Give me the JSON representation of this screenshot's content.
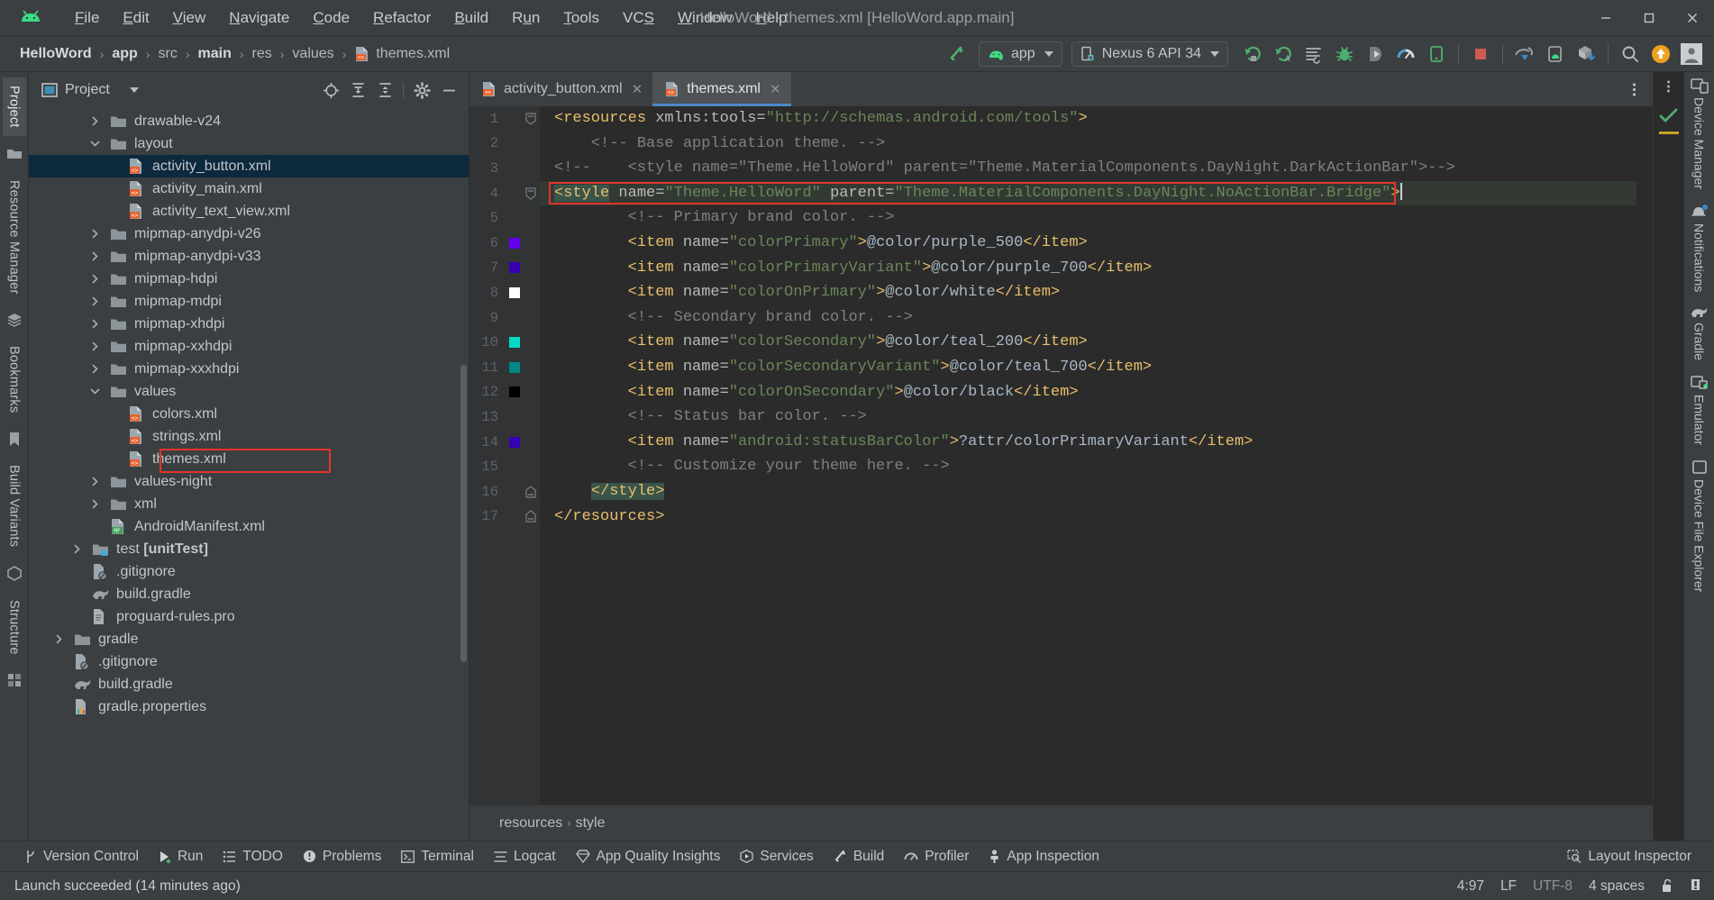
{
  "titlebar": {
    "logo_icon": "android-logo-icon",
    "menus": [
      {
        "label": "File",
        "accel": "F"
      },
      {
        "label": "Edit",
        "accel": "E"
      },
      {
        "label": "View",
        "accel": "V"
      },
      {
        "label": "Navigate",
        "accel": "N"
      },
      {
        "label": "Code",
        "accel": "C"
      },
      {
        "label": "Refactor",
        "accel": "R"
      },
      {
        "label": "Build",
        "accel": "B"
      },
      {
        "label": "Run",
        "accel": "u"
      },
      {
        "label": "Tools",
        "accel": "T"
      },
      {
        "label": "VCS",
        "accel": "S"
      },
      {
        "label": "Window",
        "accel": "W"
      },
      {
        "label": "Help",
        "accel": "H"
      }
    ],
    "window_title": "HelloWord - themes.xml [HelloWord.app.main]",
    "minimize": "—",
    "maximize": "☐",
    "close": "✕"
  },
  "toolbar": {
    "breadcrumbs": [
      {
        "label": "HelloWord",
        "bold": true
      },
      {
        "label": "app",
        "bold": true
      },
      {
        "label": "src",
        "bold": false
      },
      {
        "label": "main",
        "bold": true
      },
      {
        "label": "res",
        "bold": false
      },
      {
        "label": "values",
        "bold": false
      },
      {
        "label": "themes.xml",
        "bold": false,
        "icon": "xml-file-icon"
      }
    ],
    "separator": "›",
    "build_icon": "build-hammer-icon",
    "run_config": {
      "label": "app",
      "icon": "android-app-icon"
    },
    "device": {
      "label": "Nexus 6 API 34",
      "icon": "device-phone-icon"
    },
    "actions": [
      {
        "name": "run-button",
        "icon": "run-arrow-icon"
      },
      {
        "name": "apply-changes-button",
        "icon": "apply-changes-icon"
      },
      {
        "name": "run-with-coverage-button",
        "icon": "coverage-icon"
      },
      {
        "name": "debug-button",
        "icon": "debug-bug-icon"
      },
      {
        "name": "attach-debugger-button",
        "icon": "attach-debugger-icon"
      },
      {
        "name": "profiler-button",
        "icon": "profiler-gauge-icon"
      },
      {
        "name": "logcat-button",
        "icon": "logcat-icon"
      },
      {
        "name": "stop-button",
        "icon": "stop-square-icon"
      },
      {
        "name": "device-mirroring-button",
        "icon": "device-mirror-icon"
      },
      {
        "name": "device-explorer-button",
        "icon": "device-explorer-icon"
      },
      {
        "name": "sdk-download-button",
        "icon": "sdk-download-icon"
      },
      {
        "name": "search-everywhere-button",
        "icon": "search-icon"
      },
      {
        "name": "update-button",
        "icon": "update-arrow-icon"
      },
      {
        "name": "account-button",
        "icon": "avatar-icon"
      }
    ]
  },
  "left_rail": {
    "tabs": [
      {
        "label": "Project",
        "active": true
      },
      {
        "label": "Resource Manager",
        "active": false
      },
      {
        "label": "Bookmarks",
        "active": false
      },
      {
        "label": "Build Variants",
        "active": false
      },
      {
        "label": "Structure",
        "active": false
      }
    ],
    "icons": [
      "folder-icon",
      "layers-icon",
      "bookmark-icon",
      "build-variants-icon",
      "structure-icon"
    ]
  },
  "project_panel": {
    "title": "Project",
    "title_icon": "project-view-icon",
    "dropdown_icon": "chevron-down-icon",
    "header_actions": [
      {
        "name": "select-opened-file-button",
        "icon": "target-crosshair-icon"
      },
      {
        "name": "expand-all-button",
        "icon": "expand-all-icon"
      },
      {
        "name": "collapse-all-button",
        "icon": "collapse-all-icon"
      },
      {
        "name": "settings-button",
        "icon": "gear-icon"
      },
      {
        "name": "hide-button",
        "icon": "minus-icon"
      }
    ],
    "tree": [
      {
        "label": "drawable-v24",
        "indent": 4,
        "arrow": "right",
        "icon": "folder-icon",
        "kind": "folder"
      },
      {
        "label": "layout",
        "indent": 4,
        "arrow": "down",
        "icon": "folder-icon",
        "kind": "folder"
      },
      {
        "label": "activity_button.xml",
        "indent": 5,
        "arrow": "none",
        "icon": "xml-file-icon",
        "kind": "xml",
        "selected": true
      },
      {
        "label": "activity_main.xml",
        "indent": 5,
        "arrow": "none",
        "icon": "xml-file-icon",
        "kind": "xml"
      },
      {
        "label": "activity_text_view.xml",
        "indent": 5,
        "arrow": "none",
        "icon": "xml-file-icon",
        "kind": "xml"
      },
      {
        "label": "mipmap-anydpi-v26",
        "indent": 4,
        "arrow": "right",
        "icon": "folder-icon",
        "kind": "folder"
      },
      {
        "label": "mipmap-anydpi-v33",
        "indent": 4,
        "arrow": "right",
        "icon": "folder-icon",
        "kind": "folder"
      },
      {
        "label": "mipmap-hdpi",
        "indent": 4,
        "arrow": "right",
        "icon": "folder-icon",
        "kind": "folder"
      },
      {
        "label": "mipmap-mdpi",
        "indent": 4,
        "arrow": "right",
        "icon": "folder-icon",
        "kind": "folder"
      },
      {
        "label": "mipmap-xhdpi",
        "indent": 4,
        "arrow": "right",
        "icon": "folder-icon",
        "kind": "folder"
      },
      {
        "label": "mipmap-xxhdpi",
        "indent": 4,
        "arrow": "right",
        "icon": "folder-icon",
        "kind": "folder"
      },
      {
        "label": "mipmap-xxxhdpi",
        "indent": 4,
        "arrow": "right",
        "icon": "folder-icon",
        "kind": "folder"
      },
      {
        "label": "values",
        "indent": 4,
        "arrow": "down",
        "icon": "folder-icon",
        "kind": "folder"
      },
      {
        "label": "colors.xml",
        "indent": 5,
        "arrow": "none",
        "icon": "xml-file-icon",
        "kind": "xml"
      },
      {
        "label": "strings.xml",
        "indent": 5,
        "arrow": "none",
        "icon": "xml-file-icon",
        "kind": "xml"
      },
      {
        "label": "themes.xml",
        "indent": 5,
        "arrow": "none",
        "icon": "xml-file-icon",
        "kind": "xml",
        "highlight_box": true
      },
      {
        "label": "values-night",
        "indent": 4,
        "arrow": "right",
        "icon": "folder-icon",
        "kind": "folder"
      },
      {
        "label": "xml",
        "indent": 4,
        "arrow": "right",
        "icon": "folder-icon",
        "kind": "folder"
      },
      {
        "label": "AndroidManifest.xml",
        "indent": 4,
        "arrow": "none",
        "icon": "manifest-file-icon",
        "kind": "manifest"
      },
      {
        "label": "test [unitTest]",
        "indent": 3,
        "arrow": "right",
        "icon": "test-folder-icon",
        "kind": "folder",
        "bold_part": "[unitTest]"
      },
      {
        "label": ".gitignore",
        "indent": 3,
        "arrow": "none",
        "icon": "gitignore-file-icon",
        "kind": "gitignore"
      },
      {
        "label": "build.gradle",
        "indent": 3,
        "arrow": "none",
        "icon": "gradle-file-icon",
        "kind": "gradle"
      },
      {
        "label": "proguard-rules.pro",
        "indent": 3,
        "arrow": "none",
        "icon": "text-file-icon",
        "kind": "text"
      },
      {
        "label": "gradle",
        "indent": 2,
        "arrow": "right",
        "icon": "folder-icon",
        "kind": "folder"
      },
      {
        "label": ".gitignore",
        "indent": 2,
        "arrow": "none",
        "icon": "gitignore-file-icon",
        "kind": "gitignore"
      },
      {
        "label": "build.gradle",
        "indent": 2,
        "arrow": "none",
        "icon": "gradle-file-icon",
        "kind": "gradle"
      },
      {
        "label": "gradle.properties",
        "indent": 2,
        "arrow": "none",
        "icon": "properties-file-icon",
        "kind": "properties"
      }
    ]
  },
  "editor": {
    "tabs": [
      {
        "label": "activity_button.xml",
        "icon": "xml-file-icon",
        "active": false,
        "close": "✕"
      },
      {
        "label": "themes.xml",
        "icon": "xml-file-icon",
        "active": true,
        "close": "✕"
      }
    ],
    "kebab_icon": "more-options-icon",
    "inspection_status_icon": "inspection-ok-checkmark",
    "line_numbers": [
      1,
      2,
      3,
      4,
      5,
      6,
      7,
      8,
      9,
      10,
      11,
      12,
      13,
      14,
      15,
      16,
      17
    ],
    "gutter_swatches": [
      {
        "line": 6,
        "color": "#6200ee"
      },
      {
        "line": 7,
        "color": "#3700b3"
      },
      {
        "line": 8,
        "color": "#ffffff"
      },
      {
        "line": 10,
        "color": "#03dac5"
      },
      {
        "line": 11,
        "color": "#018786"
      },
      {
        "line": 12,
        "color": "#000000"
      },
      {
        "line": 14,
        "color": "#3700b3"
      }
    ],
    "code_lines": [
      {
        "n": 1,
        "tokens": [
          {
            "t": "<resources",
            "c": "tag"
          },
          {
            "t": " ",
            "c": "txt"
          },
          {
            "t": "xmlns:tools=",
            "c": "attr"
          },
          {
            "t": "\"http://schemas.android.com/tools\"",
            "c": "val"
          },
          {
            "t": ">",
            "c": "tag"
          }
        ]
      },
      {
        "n": 2,
        "tokens": [
          {
            "t": "    <!-- Base application theme. -->",
            "c": "cmt"
          }
        ]
      },
      {
        "n": 3,
        "tokens": [
          {
            "t": "<!--    <style name=\"Theme.HelloWord\" parent=\"Theme.MaterialComponents.DayNight.DarkActionBar\">-->",
            "c": "cmt"
          }
        ]
      },
      {
        "n": 4,
        "highlight": true,
        "boxed": true,
        "tokens": [
          {
            "t": "<style",
            "c": "tag",
            "bg": "green"
          },
          {
            "t": " ",
            "c": "txt"
          },
          {
            "t": "name=",
            "c": "attr"
          },
          {
            "t": "\"Theme.HelloWord\"",
            "c": "val"
          },
          {
            "t": " ",
            "c": "txt"
          },
          {
            "t": "parent=",
            "c": "attr"
          },
          {
            "t": "\"Theme.MaterialComponents.DayNight.NoActionBar.Bridge\"",
            "c": "val"
          },
          {
            "t": ">",
            "c": "tag"
          }
        ],
        "caret": true
      },
      {
        "n": 5,
        "tokens": [
          {
            "t": "        <!-- Primary brand color. -->",
            "c": "cmt"
          }
        ]
      },
      {
        "n": 6,
        "tokens": [
          {
            "t": "        <item",
            "c": "tag"
          },
          {
            "t": " ",
            "c": "txt"
          },
          {
            "t": "name=",
            "c": "attr"
          },
          {
            "t": "\"colorPrimary\"",
            "c": "val"
          },
          {
            "t": ">",
            "c": "tag"
          },
          {
            "t": "@color/purple_500",
            "c": "txt"
          },
          {
            "t": "</item>",
            "c": "tag"
          }
        ]
      },
      {
        "n": 7,
        "tokens": [
          {
            "t": "        <item",
            "c": "tag"
          },
          {
            "t": " ",
            "c": "txt"
          },
          {
            "t": "name=",
            "c": "attr"
          },
          {
            "t": "\"colorPrimaryVariant\"",
            "c": "val"
          },
          {
            "t": ">",
            "c": "tag"
          },
          {
            "t": "@color/purple_700",
            "c": "txt"
          },
          {
            "t": "</item>",
            "c": "tag"
          }
        ]
      },
      {
        "n": 8,
        "tokens": [
          {
            "t": "        <item",
            "c": "tag"
          },
          {
            "t": " ",
            "c": "txt"
          },
          {
            "t": "name=",
            "c": "attr"
          },
          {
            "t": "\"colorOnPrimary\"",
            "c": "val"
          },
          {
            "t": ">",
            "c": "tag"
          },
          {
            "t": "@color/white",
            "c": "txt"
          },
          {
            "t": "</item>",
            "c": "tag"
          }
        ]
      },
      {
        "n": 9,
        "tokens": [
          {
            "t": "        <!-- Secondary brand color. -->",
            "c": "cmt"
          }
        ]
      },
      {
        "n": 10,
        "tokens": [
          {
            "t": "        <item",
            "c": "tag"
          },
          {
            "t": " ",
            "c": "txt"
          },
          {
            "t": "name=",
            "c": "attr"
          },
          {
            "t": "\"colorSecondary\"",
            "c": "val"
          },
          {
            "t": ">",
            "c": "tag"
          },
          {
            "t": "@color/teal_200",
            "c": "txt"
          },
          {
            "t": "</item>",
            "c": "tag"
          }
        ]
      },
      {
        "n": 11,
        "tokens": [
          {
            "t": "        <item",
            "c": "tag"
          },
          {
            "t": " ",
            "c": "txt"
          },
          {
            "t": "name=",
            "c": "attr"
          },
          {
            "t": "\"colorSecondaryVariant\"",
            "c": "val"
          },
          {
            "t": ">",
            "c": "tag"
          },
          {
            "t": "@color/teal_700",
            "c": "txt"
          },
          {
            "t": "</item>",
            "c": "tag"
          }
        ]
      },
      {
        "n": 12,
        "tokens": [
          {
            "t": "        <item",
            "c": "tag"
          },
          {
            "t": " ",
            "c": "txt"
          },
          {
            "t": "name=",
            "c": "attr"
          },
          {
            "t": "\"colorOnSecondary\"",
            "c": "val"
          },
          {
            "t": ">",
            "c": "tag"
          },
          {
            "t": "@color/black",
            "c": "txt"
          },
          {
            "t": "</item>",
            "c": "tag"
          }
        ]
      },
      {
        "n": 13,
        "tokens": [
          {
            "t": "        <!-- Status bar color. -->",
            "c": "cmt"
          }
        ]
      },
      {
        "n": 14,
        "tokens": [
          {
            "t": "        <item",
            "c": "tag"
          },
          {
            "t": " ",
            "c": "txt"
          },
          {
            "t": "name=",
            "c": "attr"
          },
          {
            "t": "\"android:statusBarColor\"",
            "c": "val"
          },
          {
            "t": ">",
            "c": "tag"
          },
          {
            "t": "?attr/colorPrimaryVariant",
            "c": "txt"
          },
          {
            "t": "</item>",
            "c": "tag"
          }
        ]
      },
      {
        "n": 15,
        "tokens": [
          {
            "t": "        <!-- Customize your theme here. -->",
            "c": "cmt"
          }
        ]
      },
      {
        "n": 16,
        "tokens": [
          {
            "t": "    ",
            "c": "txt"
          },
          {
            "t": "</style>",
            "c": "tag",
            "bg": "green"
          }
        ]
      },
      {
        "n": 17,
        "tokens": [
          {
            "t": "</resources>",
            "c": "tag"
          }
        ]
      }
    ],
    "breadcrumbs": [
      "resources",
      "style"
    ],
    "breadcrumb_sep": "›"
  },
  "right_rail": {
    "items": [
      {
        "label": "Device Manager",
        "icon": "device-manager-icon"
      },
      {
        "label": "Notifications",
        "icon": "notifications-bell-icon"
      },
      {
        "label": "Gradle",
        "icon": "gradle-elephant-icon"
      },
      {
        "label": "Emulator",
        "icon": "emulator-icon"
      },
      {
        "label": "Device File Explorer",
        "icon": "device-file-explorer-icon"
      }
    ]
  },
  "bottom_bar": {
    "items": [
      {
        "label": "Version Control",
        "icon": "vcs-branch-icon"
      },
      {
        "label": "Run",
        "icon": "run-arrow-icon"
      },
      {
        "label": "TODO",
        "icon": "todo-list-icon"
      },
      {
        "label": "Problems",
        "icon": "problems-icon"
      },
      {
        "label": "Terminal",
        "icon": "terminal-icon"
      },
      {
        "label": "Logcat",
        "icon": "logcat-icon"
      },
      {
        "label": "App Quality Insights",
        "icon": "app-quality-insights-icon"
      },
      {
        "label": "Services",
        "icon": "services-icon"
      },
      {
        "label": "Build",
        "icon": "build-hammer-icon"
      },
      {
        "label": "Profiler",
        "icon": "profiler-gauge-icon"
      },
      {
        "label": "App Inspection",
        "icon": "app-inspection-icon"
      }
    ],
    "right_item": {
      "label": "Layout Inspector",
      "icon": "layout-inspector-icon"
    }
  },
  "status_bar": {
    "message": "Launch succeeded (14 minutes ago)",
    "caret_position": "4:97",
    "line_separator": "LF",
    "encoding": "UTF-8",
    "indent": "4 spaces",
    "lock_icon": "unlocked-padlock-icon",
    "notification_icon": "event-log-icon"
  }
}
